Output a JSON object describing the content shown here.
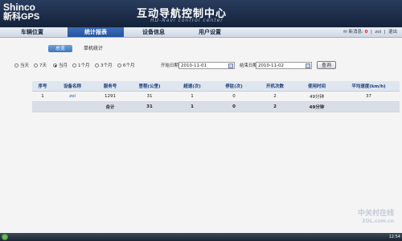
{
  "header": {
    "brand_line1": "Shinco",
    "brand_line2": "新科GPS",
    "title": "互动导航控制中心",
    "subtitle": "HD-Navi control center"
  },
  "nav": {
    "items": [
      {
        "label": "车辆位置"
      },
      {
        "label": "统计报表"
      },
      {
        "label": "设备信息"
      },
      {
        "label": "用户设置"
      }
    ],
    "msg_label": "新消息",
    "msg_count": "0",
    "user": "zol",
    "logout": "退出"
  },
  "tabs": [
    {
      "label": "总览"
    },
    {
      "label": "单机统计"
    }
  ],
  "filter": {
    "ranges": [
      {
        "label": "当天",
        "checked": false
      },
      {
        "label": "7天",
        "checked": false
      },
      {
        "label": "当月",
        "checked": true
      },
      {
        "label": "1个月",
        "checked": false
      },
      {
        "label": "3个月",
        "checked": false
      },
      {
        "label": "6个月",
        "checked": false
      }
    ],
    "start_label": "开始日期",
    "start_value": "2010-11-01",
    "end_label": "结束日期",
    "end_value": "2010-11-02",
    "query_label": "查询"
  },
  "table": {
    "headers": [
      "序号",
      "设备名称",
      "服务号",
      "里程(公里)",
      "超速(次)",
      "停驻(次)",
      "开机次数",
      "使用时间",
      "平均速度(km/h)"
    ],
    "rows": [
      [
        "1",
        "zol",
        "1291",
        "31",
        "1",
        "0",
        "2",
        "49分钟",
        "37"
      ]
    ],
    "total": [
      "",
      "",
      "合计",
      "31",
      "1",
      "0",
      "2",
      "49分钟",
      ""
    ]
  },
  "watermark": {
    "line1": "中关村在线",
    "line2": "ZOL.com.cn"
  },
  "taskbar": {
    "clock": "12:54"
  }
}
